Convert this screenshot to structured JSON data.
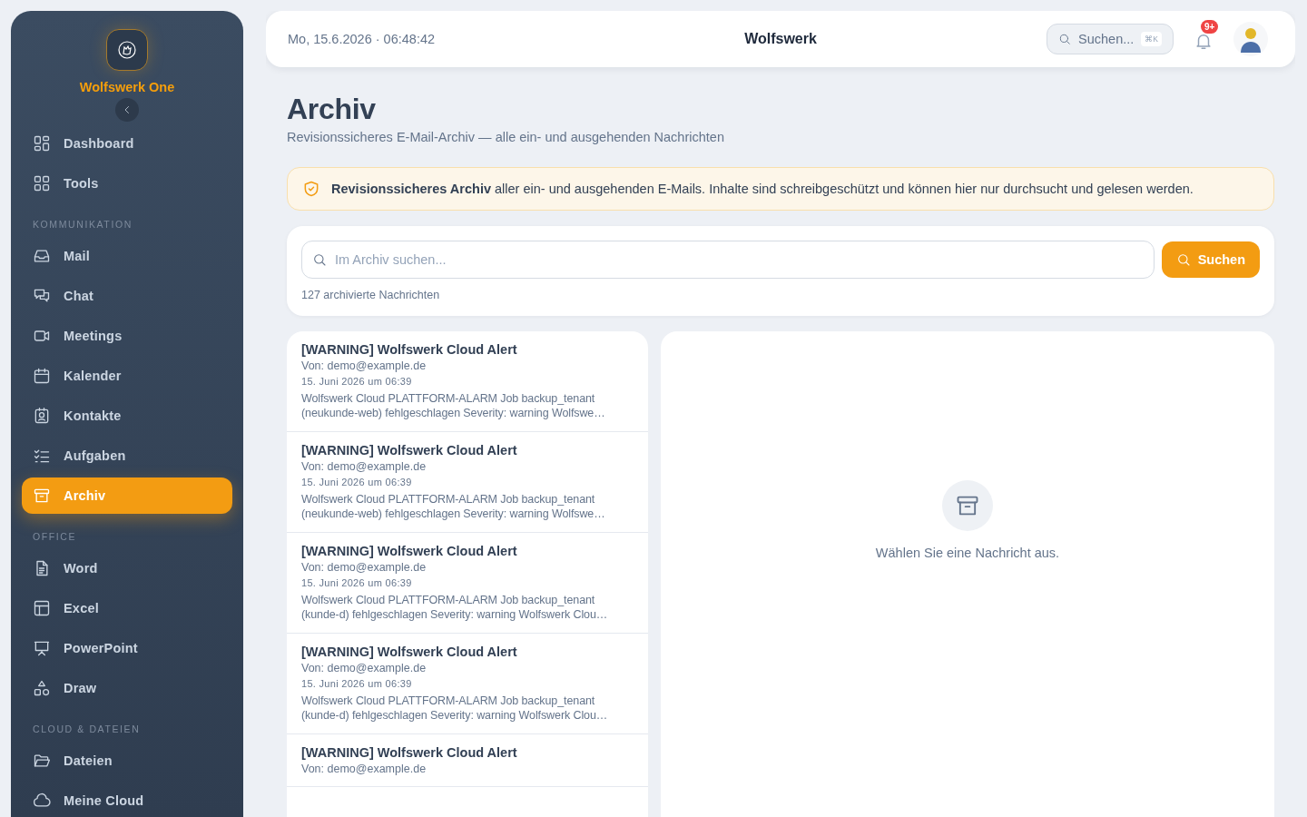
{
  "sidebar": {
    "brand": "Wolfswerk One",
    "nav": [
      {
        "kind": "item",
        "label": "Dashboard",
        "selected": false
      },
      {
        "kind": "item",
        "label": "Tools",
        "selected": false
      },
      {
        "kind": "heading",
        "label": "KOMMUNIKATION"
      },
      {
        "kind": "item",
        "label": "Mail",
        "selected": false
      },
      {
        "kind": "item",
        "label": "Chat",
        "selected": false
      },
      {
        "kind": "item",
        "label": "Meetings",
        "selected": false
      },
      {
        "kind": "item",
        "label": "Kalender",
        "selected": false
      },
      {
        "kind": "item",
        "label": "Kontakte",
        "selected": false
      },
      {
        "kind": "item",
        "label": "Aufgaben",
        "selected": false
      },
      {
        "kind": "item",
        "label": "Archiv",
        "selected": true
      },
      {
        "kind": "heading",
        "label": "OFFICE"
      },
      {
        "kind": "item",
        "label": "Word",
        "selected": false
      },
      {
        "kind": "item",
        "label": "Excel",
        "selected": false
      },
      {
        "kind": "item",
        "label": "PowerPoint",
        "selected": false
      },
      {
        "kind": "item",
        "label": "Draw",
        "selected": false
      },
      {
        "kind": "heading",
        "label": "CLOUD & DATEIEN"
      },
      {
        "kind": "item",
        "label": "Dateien",
        "selected": false
      },
      {
        "kind": "item",
        "label": "Meine Cloud",
        "selected": false
      }
    ]
  },
  "header": {
    "datetime": "Mo, 15.6.2026 · 06:48:42",
    "title": "Wolfswerk",
    "search": {
      "placeholder": "Suchen...",
      "shortcut": "⌘K"
    },
    "notifications_badge": "9+"
  },
  "page": {
    "title": "Archiv",
    "subtitle": "Revisionssicheres E-Mail-Archiv — alle ein- und ausgehenden Nachrichten",
    "notice": "**Revisionssicheres Archiv** aller ein- und ausgehenden E-Mails. Inhalte sind schreibgeschützt und können hier nur durchsucht und gelesen werden.",
    "search": {
      "placeholder": "Im Archiv suchen...",
      "button": "Suchen",
      "count": "127 archivierte Nachrichten"
    },
    "messages": [
      {
        "subject": "[WARNING] Wolfswerk Cloud Alert",
        "from": "Von: demo@example.de",
        "date": "15. Juni 2026 um 06:39",
        "preview": "Wolfswerk Cloud PLATTFORM-ALARM Job backup_tenant (neukunde-web) fehlgeschlagen Severity: warning Wolfswe…",
        "selected": false
      },
      {
        "subject": "[WARNING] Wolfswerk Cloud Alert",
        "from": "Von: demo@example.de",
        "date": "15. Juni 2026 um 06:39",
        "preview": "Wolfswerk Cloud PLATTFORM-ALARM Job backup_tenant (neukunde-web) fehlgeschlagen Severity: warning Wolfswe…",
        "selected": false
      },
      {
        "subject": "[WARNING] Wolfswerk Cloud Alert",
        "from": "Von: demo@example.de",
        "date": "15. Juni 2026 um 06:39",
        "preview": "Wolfswerk Cloud PLATTFORM-ALARM Job backup_tenant (kunde-d) fehlgeschlagen Severity: warning Wolfswerk Clou…",
        "selected": false
      },
      {
        "subject": "[WARNING] Wolfswerk Cloud Alert",
        "from": "Von: demo@example.de",
        "date": "15. Juni 2026 um 06:39",
        "preview": "Wolfswerk Cloud PLATTFORM-ALARM Job backup_tenant (kunde-d) fehlgeschlagen Severity: warning Wolfswerk Clou…",
        "selected": false
      },
      {
        "subject": "[WARNING] Wolfswerk Cloud Alert",
        "from": "Von: demo@example.de",
        "selected": false
      }
    ],
    "empty_state": "Wählen Sie eine Nachricht aus."
  }
}
